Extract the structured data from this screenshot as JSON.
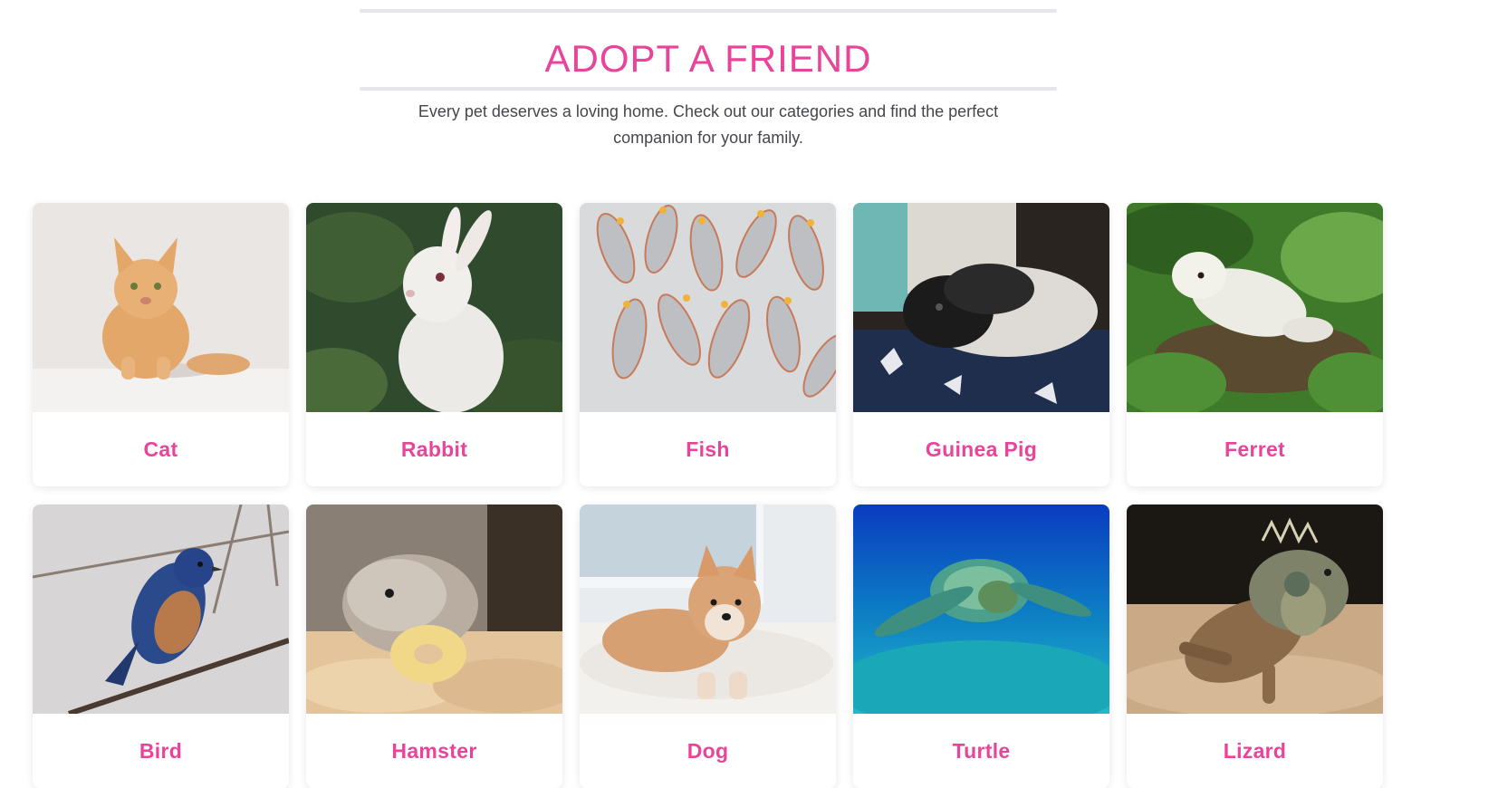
{
  "theme": {
    "accent": "#e8449a",
    "text_muted": "#45464d",
    "rule": "#e6e6ea"
  },
  "header": {
    "title": "ADOPT A FRIEND",
    "subtitle": "Every pet deserves a loving home. Check out our categories and find the perfect companion for your family."
  },
  "categories": [
    {
      "label": "Cat",
      "photo": "cat-photo"
    },
    {
      "label": "Rabbit",
      "photo": "rabbit-photo"
    },
    {
      "label": "Fish",
      "photo": "fish-photo"
    },
    {
      "label": "Guinea Pig",
      "photo": "guinea-pig-photo"
    },
    {
      "label": "Ferret",
      "photo": "ferret-photo"
    },
    {
      "label": "Bird",
      "photo": "bird-photo"
    },
    {
      "label": "Hamster",
      "photo": "hamster-photo"
    },
    {
      "label": "Dog",
      "photo": "dog-photo"
    },
    {
      "label": "Turtle",
      "photo": "turtle-photo"
    },
    {
      "label": "Lizard",
      "photo": "lizard-photo"
    }
  ]
}
